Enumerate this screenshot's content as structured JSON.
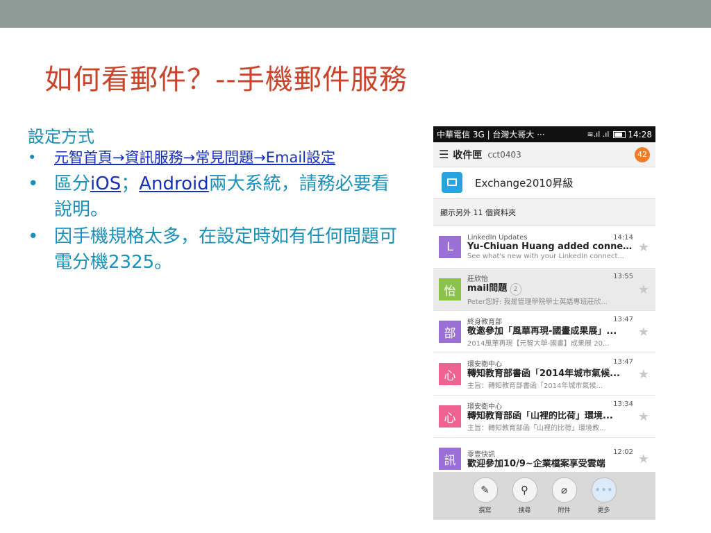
{
  "slide": {
    "title": "如何看郵件？--手機郵件服務",
    "subhead": "設定方式",
    "bullet_char": "•",
    "bullets": {
      "b1": {
        "link": "元智首頁→資訊服務→常見問題→Email設定"
      },
      "b2": {
        "t1": "區分",
        "ios": "iOS",
        "sep": "；",
        "android": "Android",
        "t2": "兩大系統，請務必要看說明。"
      },
      "b3": {
        "text": "因手機規格太多，在設定時如有任何問題可電分機2325。"
      }
    }
  },
  "phone": {
    "status": {
      "carrier": "中華電信 3G | 台灣大哥大 ···",
      "signal": "≋.ıl .ıl",
      "time": "14:28"
    },
    "appbar": {
      "menu": "☰",
      "inbox": "收件匣",
      "account": "cct0403",
      "badge": "42"
    },
    "folder": {
      "name": "Exchange2010昇級"
    },
    "more_folders": "顯示另外 11 個資料夾",
    "mails": [
      {
        "avatar": "L",
        "color": "#9a6fd6",
        "from": "LinkedIn Updates",
        "time": "14:14",
        "subject": "Yu-Chiuan Huang added connecti...",
        "preview": "See what's new with your LinkedIn connect...",
        "count": ""
      },
      {
        "avatar": "怡",
        "color": "#8bc34a",
        "from": "莊欣怡",
        "time": "13:55",
        "subject": "mail問題",
        "preview": "Peter您好: 我是管理學院學士英語專班莊欣...",
        "count": "2"
      },
      {
        "avatar": "部",
        "color": "#9a6fd6",
        "from": "終身教育部",
        "time": "13:47",
        "subject": "敬邀參加「風華再現-國畫成果展」...",
        "preview": "2014風華再現【元智大學-國畫】成果展 20...",
        "count": ""
      },
      {
        "avatar": "心",
        "color": "#f06292",
        "from": "環安衛中心",
        "time": "13:47",
        "subject": "轉知教育部書函「2014年城市氣候...",
        "preview": "主旨：轉知教育部書函「2014年城市氣候...",
        "count": ""
      },
      {
        "avatar": "心",
        "color": "#f06292",
        "from": "環安衛中心",
        "time": "13:34",
        "subject": "轉知教育部函「山裡的比荷」環境...",
        "preview": "主旨：轉知教育部函「山裡的比荷」環境教...",
        "count": ""
      },
      {
        "avatar": "訊",
        "color": "#9a6fd6",
        "from": "零壹快訊",
        "time": "12:02",
        "subject": "歡迎參加10/9~企業檔案享受雲端",
        "preview": "",
        "count": ""
      }
    ],
    "star": "★",
    "bottom": [
      {
        "icon": "compose-icon",
        "glyph": "✎",
        "label": "撰寫"
      },
      {
        "icon": "search-icon",
        "glyph": "⚲",
        "label": "搜尋"
      },
      {
        "icon": "paperclip-icon",
        "glyph": "⌀",
        "label": "附件"
      },
      {
        "icon": "more-icon",
        "glyph": "•••",
        "label": "更多"
      }
    ]
  }
}
